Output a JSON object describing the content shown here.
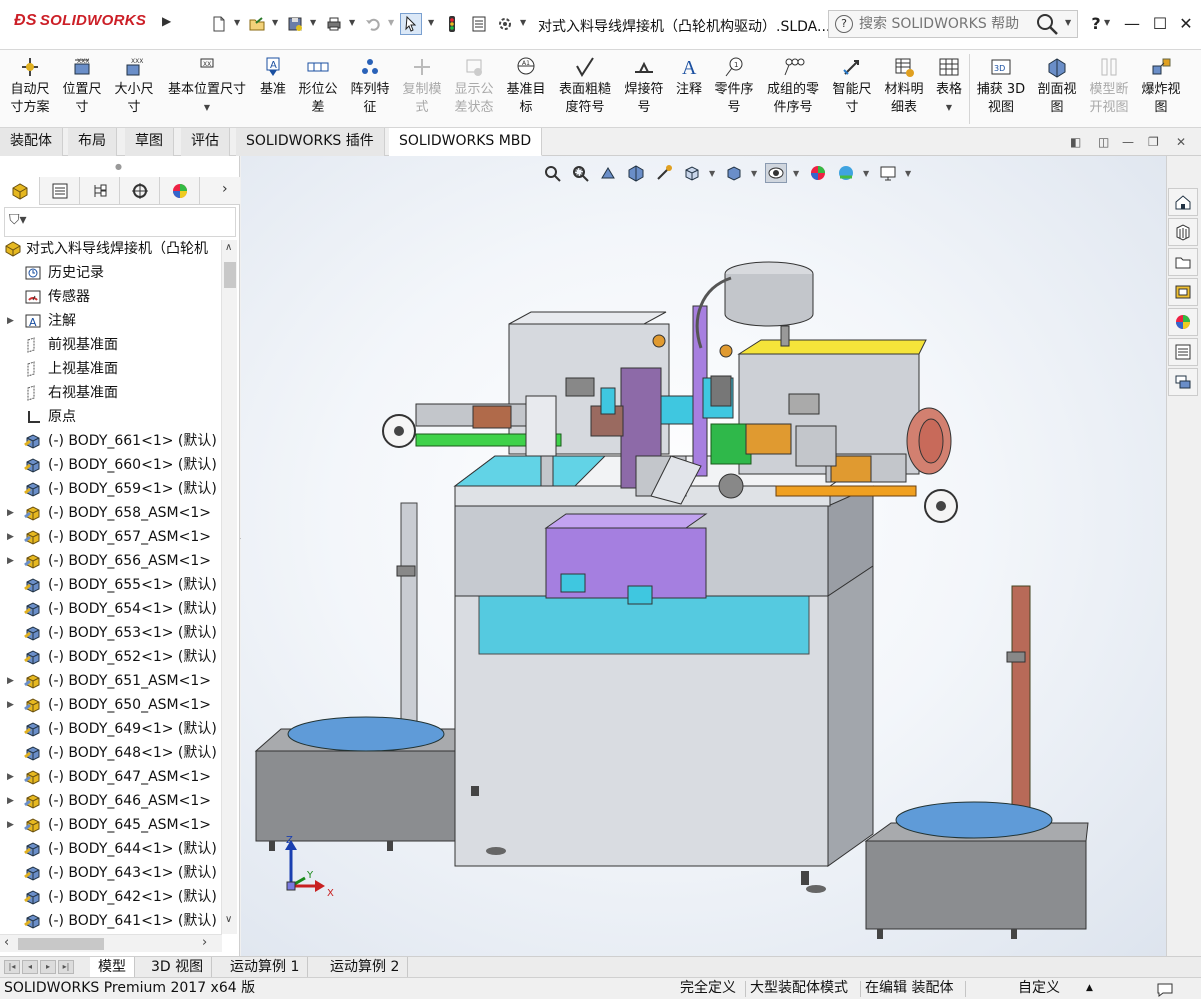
{
  "titlebar": {
    "app_logo": "SOLIDWORKS",
    "document_title": "对式入料导线焊接机（凸轮机构驱动）.SLDA...",
    "help_search_placeholder": "搜索 SOLIDWORKS 帮助",
    "help_label": "?",
    "window_buttons": [
      "—",
      "☐",
      "✕"
    ]
  },
  "ribbon": {
    "buttons": [
      {
        "label": "自动尺\n寸方案",
        "icon": "smart-dim-scheme-icon",
        "enabled": true
      },
      {
        "label": "位置尺\n寸",
        "icon": "location-dim-icon",
        "enabled": true
      },
      {
        "label": "大小尺\n寸",
        "icon": "size-dim-icon",
        "enabled": true
      },
      {
        "label": "基本位置尺寸",
        "icon": "basic-location-dim-icon",
        "enabled": true
      },
      {
        "label": "基准",
        "icon": "datum-icon",
        "enabled": true
      },
      {
        "label": "形位公\n差",
        "icon": "geometric-tolerance-icon",
        "enabled": true
      },
      {
        "label": "阵列特\n征",
        "icon": "pattern-feature-icon",
        "enabled": true
      },
      {
        "label": "复制模\n式",
        "icon": "copy-scheme-icon",
        "enabled": false
      },
      {
        "label": "显示公\n差状态",
        "icon": "show-tolerance-status-icon",
        "enabled": false
      },
      {
        "label": "基准目\n标",
        "icon": "datum-target-icon",
        "enabled": true
      },
      {
        "label": "表面粗糙\n度符号",
        "icon": "surface-finish-icon",
        "enabled": true
      },
      {
        "label": "焊接符\n号",
        "icon": "weld-symbol-icon",
        "enabled": true
      },
      {
        "label": "注释",
        "icon": "note-icon",
        "enabled": true
      },
      {
        "label": "零件序\n号",
        "icon": "balloon-icon",
        "enabled": true
      },
      {
        "label": "成组的零\n件序号",
        "icon": "stacked-balloon-icon",
        "enabled": true
      },
      {
        "label": "智能尺\n寸",
        "icon": "smart-dimension-icon",
        "enabled": true
      },
      {
        "label": "材料明\n细表",
        "icon": "bom-icon",
        "enabled": true
      },
      {
        "label": "表格",
        "icon": "table-icon",
        "enabled": true
      },
      {
        "label": "捕获 3D\n视图",
        "icon": "capture-3d-view-icon",
        "enabled": true
      },
      {
        "label": "剖面视\n图",
        "icon": "section-view-icon",
        "enabled": true
      },
      {
        "label": "模型断\n开视图",
        "icon": "model-break-view-icon",
        "enabled": false
      },
      {
        "label": "爆炸视\n图",
        "icon": "exploded-view-icon",
        "enabled": true
      }
    ]
  },
  "tabs": [
    {
      "label": "装配体",
      "active": false
    },
    {
      "label": "布局",
      "active": false
    },
    {
      "label": "草图",
      "active": false
    },
    {
      "label": "评估",
      "active": false
    },
    {
      "label": "SOLIDWORKS 插件",
      "active": false
    },
    {
      "label": "SOLIDWORKS MBD",
      "active": true
    }
  ],
  "feature_tree": {
    "root": "对式入料导线焊接机（凸轮机",
    "items": [
      {
        "label": "历史记录",
        "icon": "history-icon",
        "expandable": false
      },
      {
        "label": "传感器",
        "icon": "sensor-icon",
        "expandable": false
      },
      {
        "label": "注解",
        "icon": "annotation-icon",
        "expandable": true
      },
      {
        "label": "前视基准面",
        "icon": "plane-icon",
        "expandable": false
      },
      {
        "label": "上视基准面",
        "icon": "plane-icon",
        "expandable": false
      },
      {
        "label": "右视基准面",
        "icon": "plane-icon",
        "expandable": false
      },
      {
        "label": "原点",
        "icon": "origin-icon",
        "expandable": false
      },
      {
        "label": "(-) BODY_661<1> (默认)",
        "icon": "part-icon",
        "expandable": false
      },
      {
        "label": "(-) BODY_660<1> (默认)",
        "icon": "part-icon",
        "expandable": false
      },
      {
        "label": "(-) BODY_659<1> (默认)",
        "icon": "part-icon",
        "expandable": false
      },
      {
        "label": "(-) BODY_658_ASM<1>",
        "icon": "assembly-icon",
        "expandable": true
      },
      {
        "label": "(-) BODY_657_ASM<1>",
        "icon": "assembly-icon",
        "expandable": true
      },
      {
        "label": "(-) BODY_656_ASM<1>",
        "icon": "assembly-icon",
        "expandable": true
      },
      {
        "label": "(-) BODY_655<1> (默认)",
        "icon": "part-icon",
        "expandable": false
      },
      {
        "label": "(-) BODY_654<1> (默认)",
        "icon": "part-icon",
        "expandable": false
      },
      {
        "label": "(-) BODY_653<1> (默认)",
        "icon": "part-icon",
        "expandable": false
      },
      {
        "label": "(-) BODY_652<1> (默认)",
        "icon": "part-icon",
        "expandable": false
      },
      {
        "label": "(-) BODY_651_ASM<1>",
        "icon": "assembly-icon",
        "expandable": true
      },
      {
        "label": "(-) BODY_650_ASM<1>",
        "icon": "assembly-icon",
        "expandable": true
      },
      {
        "label": "(-) BODY_649<1> (默认)",
        "icon": "part-icon",
        "expandable": false
      },
      {
        "label": "(-) BODY_648<1> (默认)",
        "icon": "part-icon",
        "expandable": false
      },
      {
        "label": "(-) BODY_647_ASM<1>",
        "icon": "assembly-icon",
        "expandable": true
      },
      {
        "label": "(-) BODY_646_ASM<1>",
        "icon": "assembly-icon",
        "expandable": true
      },
      {
        "label": "(-) BODY_645_ASM<1>",
        "icon": "assembly-icon",
        "expandable": true
      },
      {
        "label": "(-) BODY_644<1> (默认)",
        "icon": "part-icon",
        "expandable": false
      },
      {
        "label": "(-) BODY_643<1> (默认)",
        "icon": "part-icon",
        "expandable": false
      },
      {
        "label": "(-) BODY_642<1> (默认)",
        "icon": "part-icon",
        "expandable": false
      },
      {
        "label": "(-) BODY_641<1> (默认)",
        "icon": "part-icon",
        "expandable": false
      }
    ]
  },
  "triad": {
    "x": "X",
    "y": "Y",
    "z": "Z"
  },
  "bottom_tabs": [
    {
      "label": "模型",
      "active": true
    },
    {
      "label": "3D 视图",
      "active": false
    },
    {
      "label": "运动算例 1",
      "active": false
    },
    {
      "label": "运动算例 2",
      "active": false
    }
  ],
  "status": {
    "product": "SOLIDWORKS Premium 2017 x64 版",
    "definition": "完全定义",
    "mode": "大型装配体模式",
    "editing": "在编辑 装配体",
    "units": "自定义"
  },
  "colors": {
    "brand": "#cc1f27",
    "accent_blue": "#1e4f9c",
    "viewport_bg": "#e8edf3"
  }
}
